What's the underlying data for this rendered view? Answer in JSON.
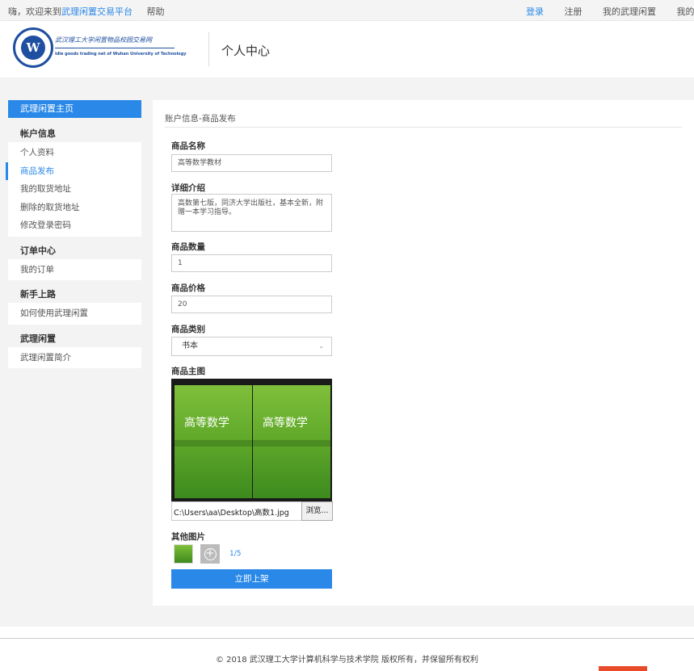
{
  "topbar": {
    "greeting": "嗨，欢迎来到",
    "brand_link": "武理闲置交易平台",
    "help": "帮助",
    "login": "登录",
    "register": "注册",
    "my_items": "我的武理闲置",
    "my_orders": "我的订单"
  },
  "header": {
    "logo_text_cn": "武汉理工大学闲置物品校园交易网",
    "logo_text_en": "idle goods trading net of Wuhan University of Technology",
    "page_title": "个人中心"
  },
  "sidebar": {
    "home": "武理闲置主页",
    "sections": [
      {
        "title": "帐户信息",
        "items": [
          "个人资料",
          "商品发布",
          "我的取货地址",
          "删除的取货地址",
          "修改登录密码"
        ]
      },
      {
        "title": "订单中心",
        "items": [
          "我的订单"
        ]
      },
      {
        "title": "新手上路",
        "items": [
          "如何使用武理闲置"
        ]
      },
      {
        "title": "武理闲置",
        "items": [
          "武理闲置简介"
        ]
      }
    ],
    "active_item": "商品发布"
  },
  "content": {
    "breadcrumb": "账户信息-商品发布",
    "form": {
      "name_label": "商品名称",
      "name_value": "高等数学教材",
      "detail_label": "详细介绍",
      "detail_value": "高数第七版，同济大学出版社，基本全新，附赠一本学习指导。",
      "quantity_label": "商品数量",
      "quantity_value": "1",
      "price_label": "商品价格",
      "price_value": "20",
      "category_label": "商品类别",
      "category_value": "书本",
      "main_image_label": "商品主图",
      "book_title": "高等数学",
      "file_path": "C:\\Users\\aa\\Desktop\\高数1.jpg",
      "browse_label": "浏览...",
      "other_images_label": "其他图片",
      "image_count": "1/5",
      "submit_label": "立即上架"
    }
  },
  "footer": {
    "copyright": "© 2018 武汉理工大学计算机科学与技术学院 版权所有，并保留所有权利"
  },
  "colors": {
    "accent": "#2a88e8",
    "logo_blue": "#1e4fa0",
    "page_bg": "#f3f3f3"
  }
}
